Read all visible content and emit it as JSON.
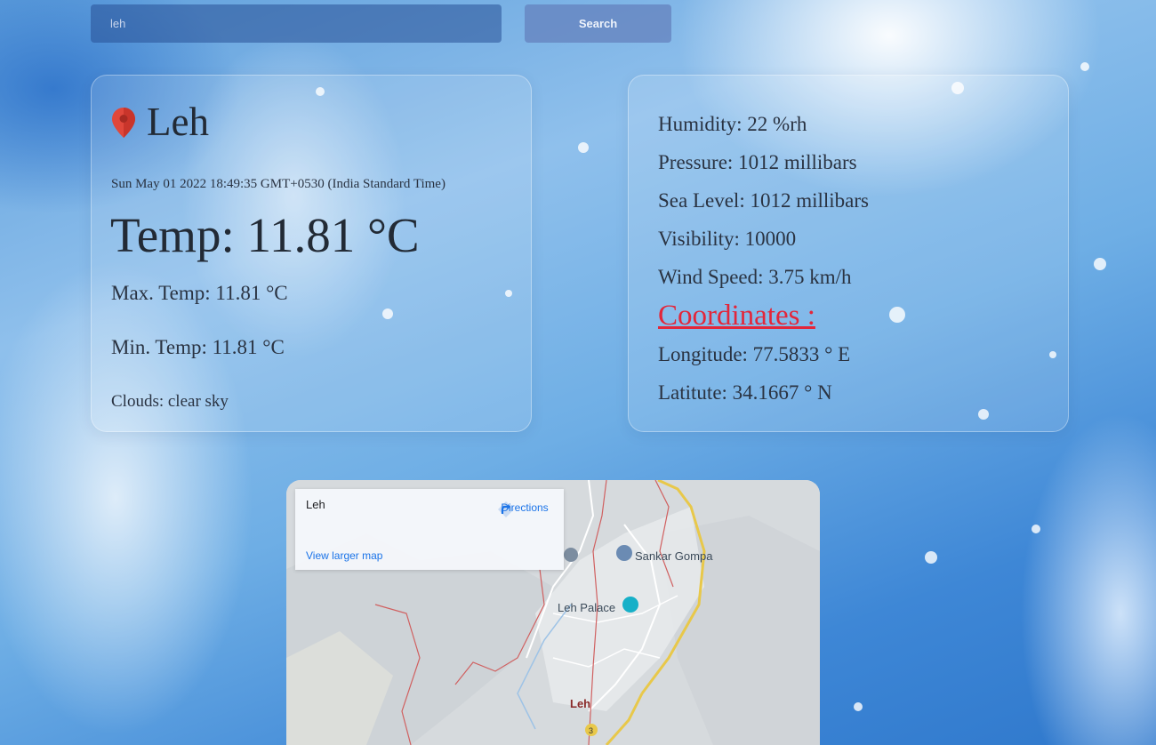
{
  "search": {
    "placeholder": "leh",
    "button_label": "Search"
  },
  "current": {
    "city": "Leh",
    "datetime": "Sun May 01 2022 18:49:35 GMT+0530 (India Standard Time)",
    "temp": "Temp: 11.81 °C",
    "max_temp": "Max. Temp: 11.81 °C",
    "min_temp": "Min. Temp: 11.81 °C",
    "clouds": "Clouds: clear sky"
  },
  "details": {
    "humidity": "Humidity: 22 %rh",
    "pressure": "Pressure: 1012 millibars",
    "sea_level": "Sea Level: 1012 millibars",
    "visibility": "Visibility: 10000",
    "wind_speed": "Wind Speed: 3.75 km/h",
    "coordinates_heading": "Coordinates :",
    "longitude": "Longitude: 77.5833 ° E",
    "latitude": "Latitute: 34.1667 ° N"
  },
  "map": {
    "place_title": "Leh",
    "view_larger_label": "View larger map",
    "directions_label": "Directions",
    "labels": {
      "sankar": "Sankar Gompa",
      "palace": "Leh Palace",
      "leh": "Leh",
      "route": "3"
    }
  },
  "colors": {
    "coordinates_accent": "#e3263a",
    "map_link": "#1a73e8"
  },
  "icons": {
    "location": "map-pin-icon",
    "directions": "directions-icon",
    "palace": "camera-icon",
    "gompa": "temple-icon"
  }
}
